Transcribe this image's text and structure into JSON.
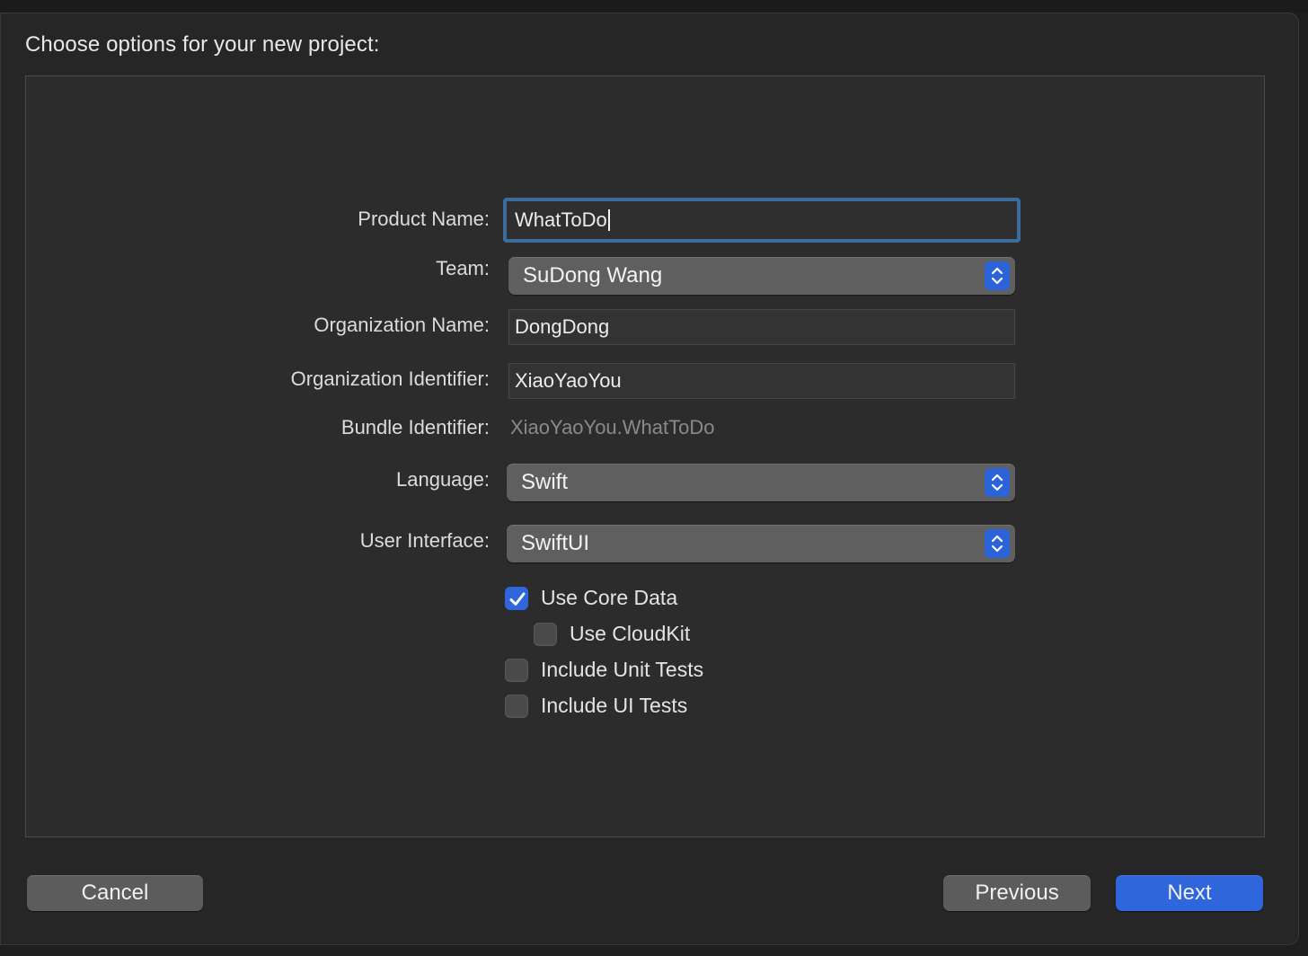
{
  "heading": "Choose options for your new project:",
  "fields": {
    "product_name": {
      "label": "Product Name:",
      "value": "WhatToDo"
    },
    "team": {
      "label": "Team:",
      "value": "SuDong Wang"
    },
    "organization_name": {
      "label": "Organization Name:",
      "value": "DongDong"
    },
    "organization_identifier": {
      "label": "Organization Identifier:",
      "value": "XiaoYaoYou"
    },
    "bundle_identifier": {
      "label": "Bundle Identifier:",
      "value": "XiaoYaoYou.WhatToDo"
    },
    "language": {
      "label": "Language:",
      "value": "Swift"
    },
    "user_interface": {
      "label": "User Interface:",
      "value": "SwiftUI"
    }
  },
  "options": {
    "use_core_data": {
      "label": "Use Core Data",
      "checked": true
    },
    "use_cloudkit": {
      "label": "Use CloudKit",
      "checked": false
    },
    "include_unit_tests": {
      "label": "Include Unit Tests",
      "checked": false
    },
    "include_ui_tests": {
      "label": "Include UI Tests",
      "checked": false
    }
  },
  "buttons": {
    "cancel": "Cancel",
    "previous": "Previous",
    "next": "Next"
  },
  "colors": {
    "accent": "#2f66dc",
    "focus_ring": "#3d6b9e",
    "background": "#262626"
  },
  "icons": {
    "popup_arrows": "chevron-up-down-icon",
    "checkmark": "checkmark-icon"
  }
}
